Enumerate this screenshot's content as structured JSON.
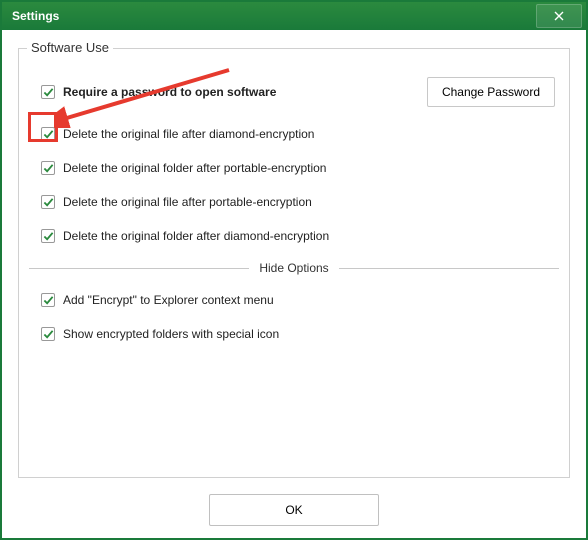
{
  "window": {
    "title": "Settings",
    "close_icon": "close"
  },
  "group": {
    "legend": "Software Use",
    "change_password_btn": "Change Password",
    "hide_options_label": "Hide Options",
    "options": [
      {
        "label": "Require a password to open software",
        "checked": true,
        "bold": true
      },
      {
        "label": "Delete the original file after diamond-encryption",
        "checked": true
      },
      {
        "label": "Delete the original folder after portable-encryption",
        "checked": true
      },
      {
        "label": "Delete the original file after portable-encryption",
        "checked": true
      },
      {
        "label": "Delete the original folder after diamond-encryption",
        "checked": true
      }
    ],
    "hide_options": [
      {
        "label": "Add \"Encrypt\" to Explorer context menu",
        "checked": true
      },
      {
        "label": "Show encrypted folders with special icon",
        "checked": true
      }
    ]
  },
  "footer": {
    "ok_label": "OK"
  },
  "annotations": {
    "highlight_target": "require-password-checkbox",
    "arrow_color": "#e63a2e"
  }
}
